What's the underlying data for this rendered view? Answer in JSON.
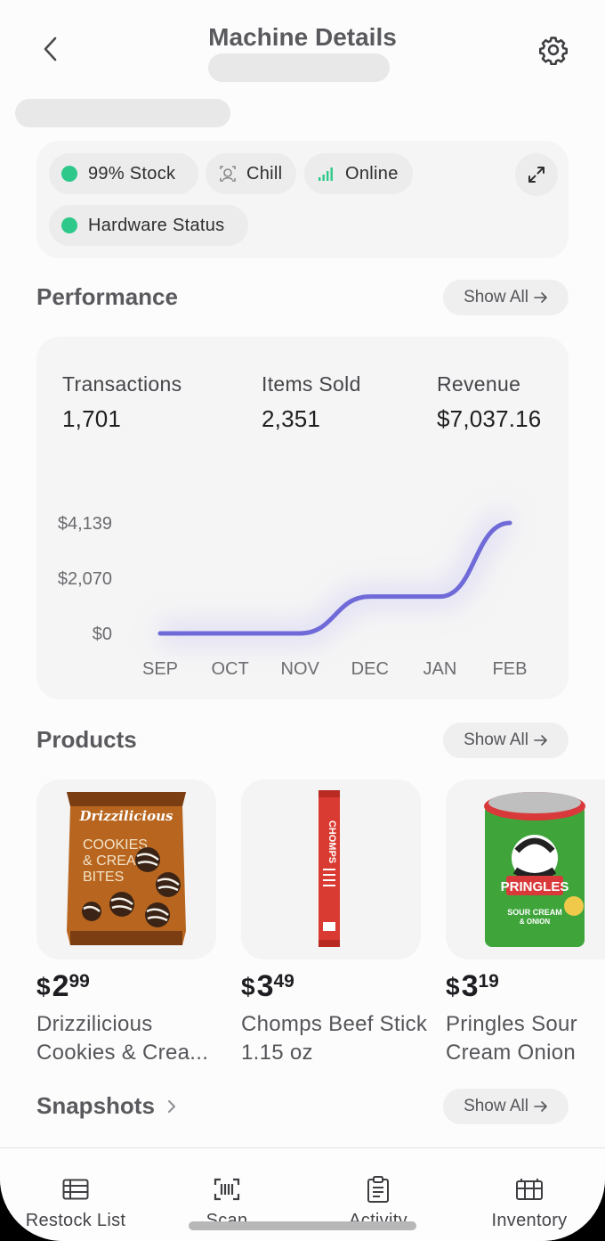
{
  "header": {
    "title": "Machine Details"
  },
  "status": {
    "chips": [
      {
        "label": "99% Stock",
        "icon": "green-dot-icon"
      },
      {
        "label": "Chill",
        "icon": "temperature-icon"
      },
      {
        "label": "Online",
        "icon": "signal-icon"
      },
      {
        "label": "Hardware Status",
        "icon": "green-dot-icon"
      }
    ]
  },
  "performance": {
    "title": "Performance",
    "show_all": "Show All",
    "metrics": [
      {
        "label": "Transactions",
        "value": "1,701"
      },
      {
        "label": "Items Sold",
        "value": "2,351"
      },
      {
        "label": "Revenue",
        "value": "$7,037.16"
      }
    ]
  },
  "chart_data": {
    "type": "line",
    "categories": [
      "SEP",
      "OCT",
      "NOV",
      "DEC",
      "JAN",
      "FEB"
    ],
    "series": [
      {
        "values": [
          0,
          0,
          0,
          1380,
          1380,
          4139
        ]
      }
    ],
    "y_ticks": [
      "$4,139",
      "$2,070",
      "$0"
    ],
    "ylim": [
      0,
      4139
    ],
    "line_color": "#6f6ad8",
    "grid": false
  },
  "products": {
    "title": "Products",
    "show_all": "Show All",
    "items": [
      {
        "currency": "$",
        "dollars": "2",
        "cents": "99",
        "name": "Drizzilicious Cookies & Crea...",
        "brand": "Drizzilicious",
        "sub": "COOKIES & CREAM BITES"
      },
      {
        "currency": "$",
        "dollars": "3",
        "cents": "49",
        "name": "Chomps Beef Stick 1.15 oz",
        "brand": "CHOMPS"
      },
      {
        "currency": "$",
        "dollars": "3",
        "cents": "19",
        "name": "Pringles Sour Cream Onion",
        "brand": "PRINGLES",
        "sub": "SOUR CREAM & ONION"
      }
    ]
  },
  "snapshots": {
    "title": "Snapshots",
    "show_all": "Show All"
  },
  "tabbar": {
    "tabs": [
      {
        "label": "Restock List",
        "icon": "list-icon"
      },
      {
        "label": "Scan",
        "icon": "scan-icon"
      },
      {
        "label": "Activity",
        "icon": "clipboard-icon"
      },
      {
        "label": "Inventory",
        "icon": "inventory-icon"
      }
    ]
  },
  "colors": {
    "accent": "#6f6ad8",
    "status_green": "#2ec98a"
  }
}
